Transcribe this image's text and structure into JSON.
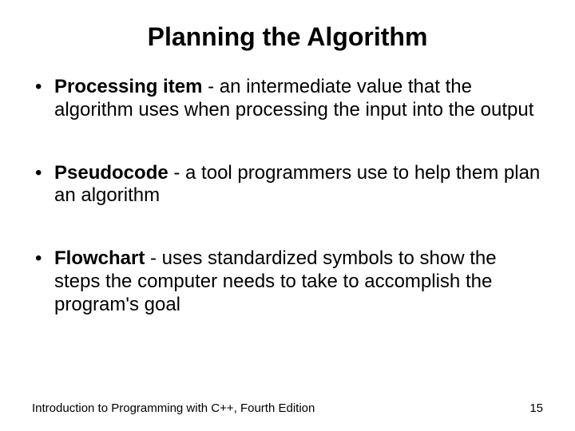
{
  "title": "Planning the Algorithm",
  "bullets": [
    {
      "term": "Processing item",
      "def": " - an intermediate value that the algorithm uses when processing the input into the output"
    },
    {
      "term": "Pseudocode",
      "def": " - a tool programmers use to help them plan an algorithm"
    },
    {
      "term": "Flowchart",
      "def": " - uses standardized symbols to show the steps the computer needs to take to accomplish the program's goal"
    }
  ],
  "footer": {
    "left": "Introduction to Programming with C++, Fourth Edition",
    "right": "15"
  }
}
